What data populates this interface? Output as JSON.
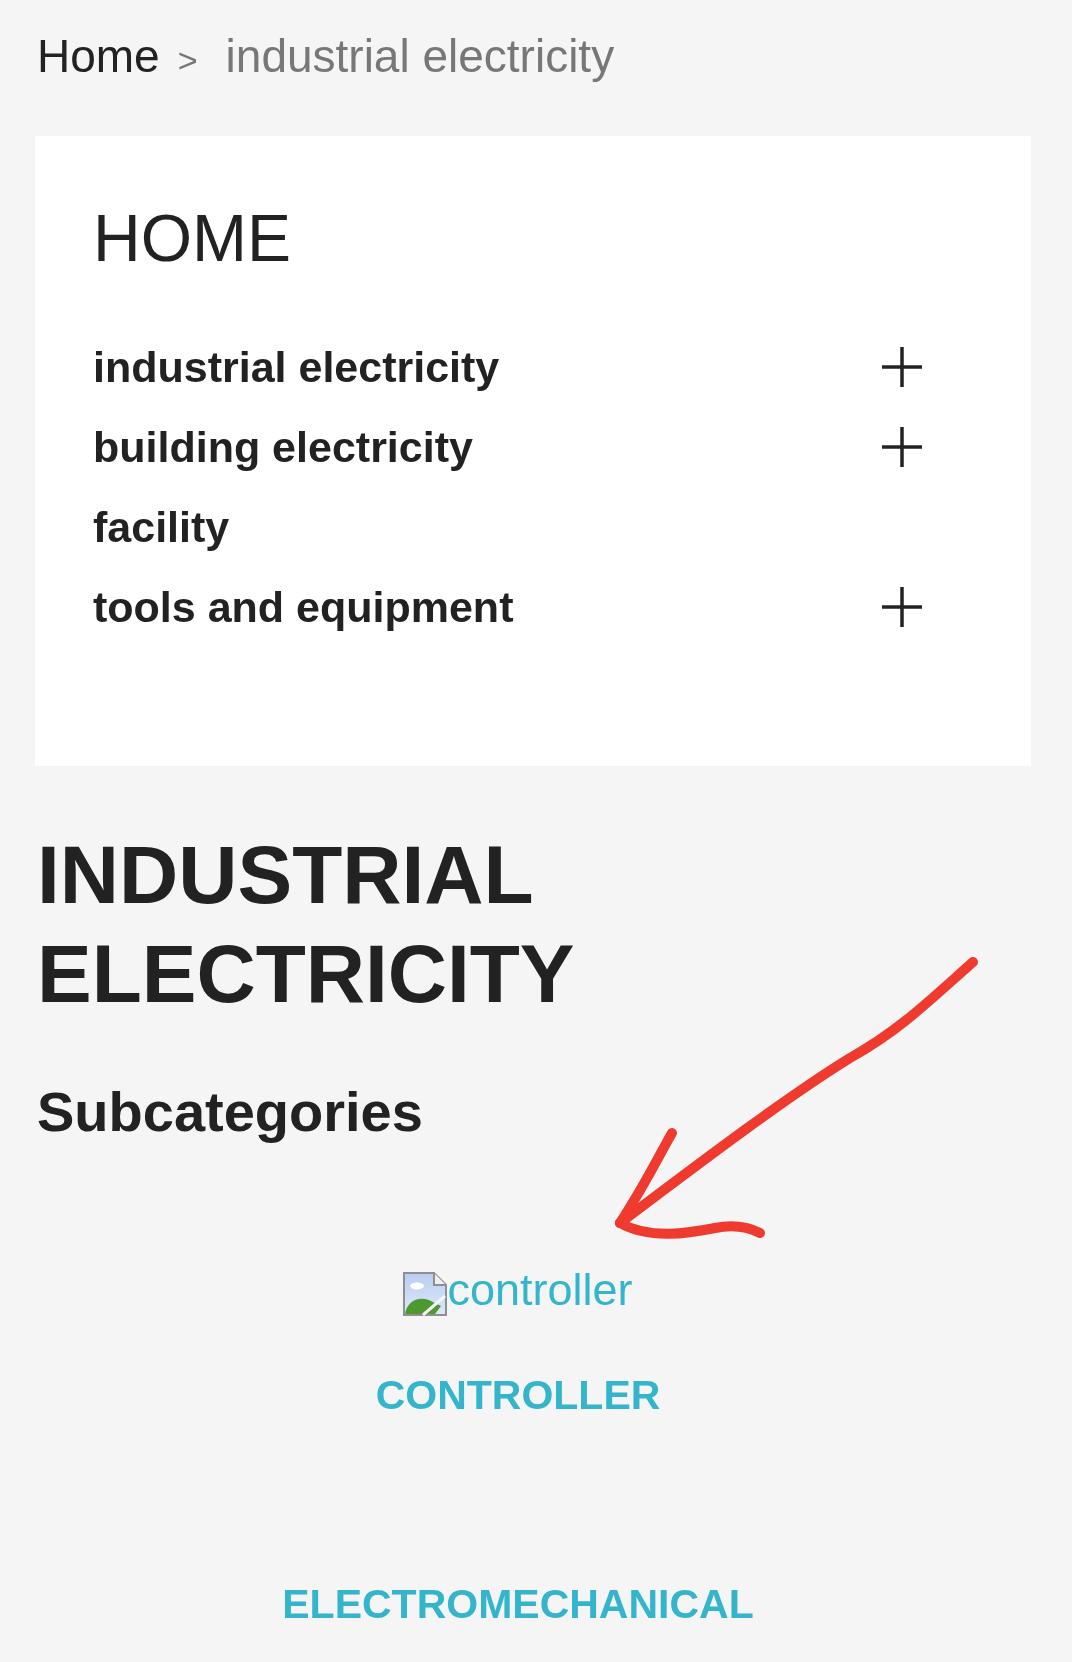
{
  "breadcrumb": {
    "separator": ">",
    "items": [
      {
        "label": "Home",
        "current": false
      },
      {
        "label": "industrial electricity",
        "current": true
      }
    ]
  },
  "menu": {
    "title": "HOME",
    "items": [
      {
        "label": "industrial electricity",
        "expandable": true
      },
      {
        "label": "building electricity",
        "expandable": true
      },
      {
        "label": "facility",
        "expandable": false
      },
      {
        "label": "tools and equipment",
        "expandable": true
      }
    ]
  },
  "page_title": "INDUSTRIAL ELECTRICITY",
  "subcategories": {
    "heading": "Subcategories",
    "items": [
      {
        "image_alt": "controller",
        "title": "CONTROLLER"
      },
      {
        "title": "ELECTROMECHANICAL"
      }
    ]
  }
}
